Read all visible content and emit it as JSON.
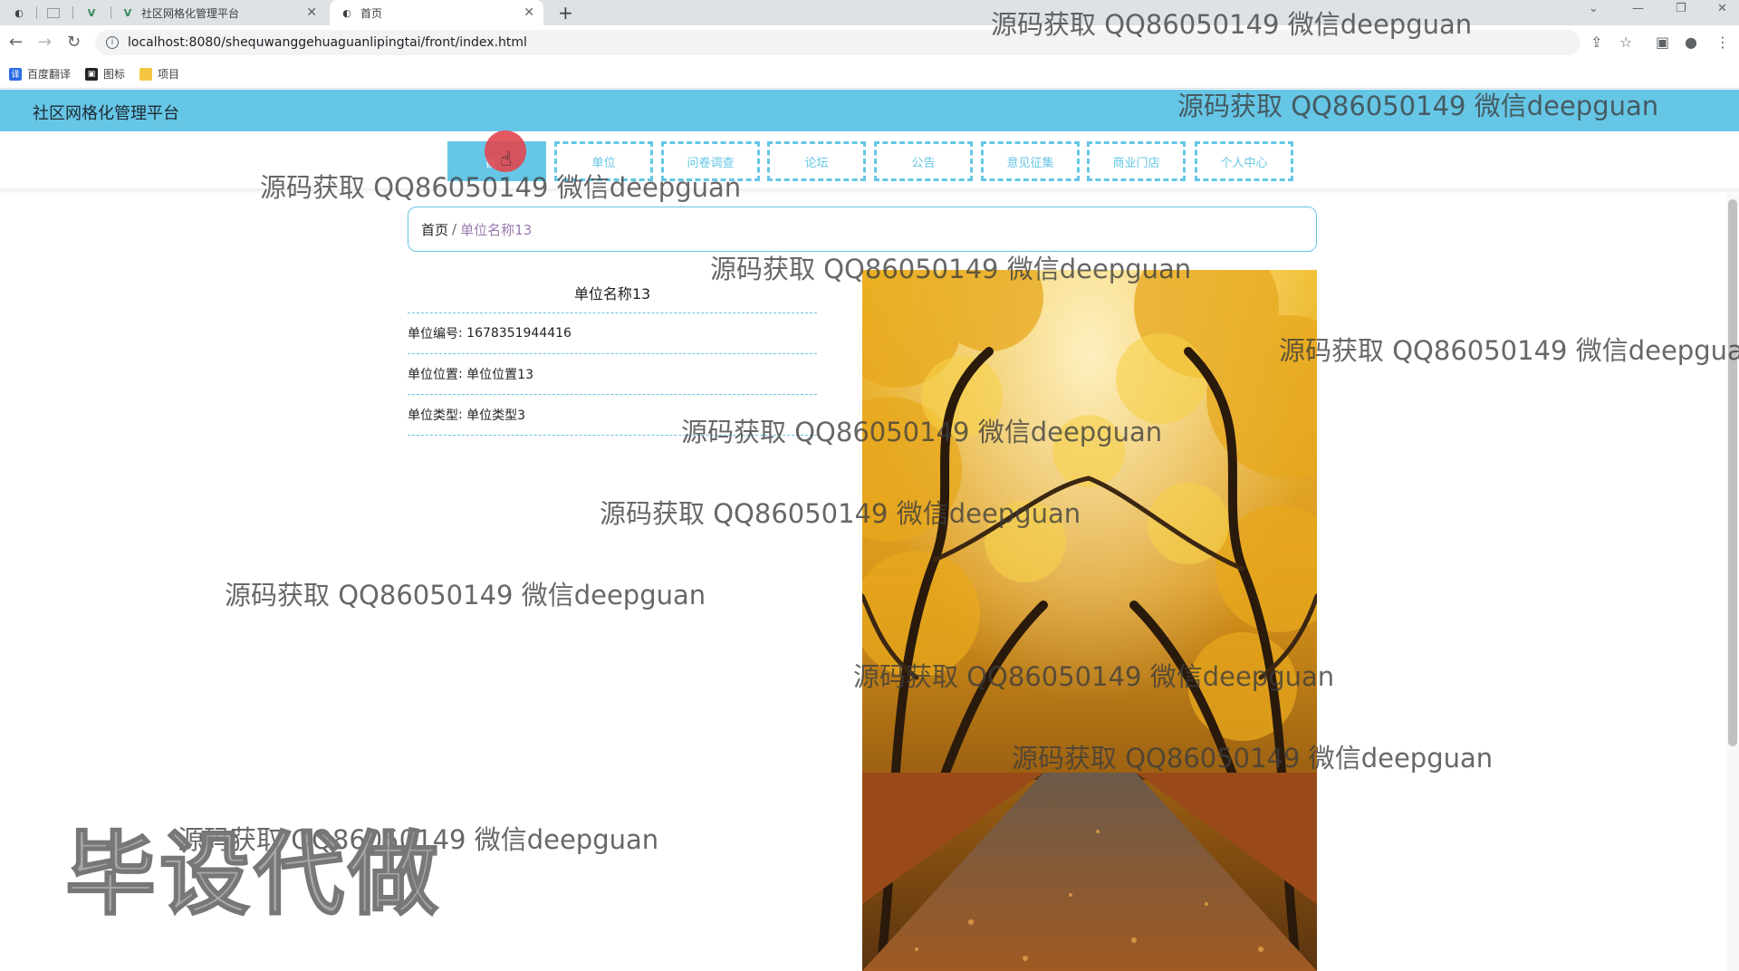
{
  "browser": {
    "tabs": [
      {
        "title": "社区网格化管理平台",
        "icon": "vue-logo-icon"
      },
      {
        "title": "首页",
        "icon": "globe-icon"
      }
    ],
    "url": "localhost:8080/shequwanggehuaguanlipingtai/front/index.html",
    "bookmarks": [
      {
        "label": "百度翻译",
        "icon": "translate-icon",
        "color": "#2b6de5"
      },
      {
        "label": "图标",
        "icon": "image-icon",
        "color": "#222222"
      },
      {
        "label": "项目",
        "icon": "folder-icon",
        "color": "#f4c542"
      }
    ]
  },
  "app": {
    "title": "社区网格化管理平台",
    "accent": "#66c6e6",
    "menu": [
      "首页",
      "单位",
      "问卷调查",
      "论坛",
      "公告",
      "意见征集",
      "商业门店",
      "个人中心"
    ],
    "active_menu": "首页"
  },
  "breadcrumb": {
    "home": "首页",
    "separator": "/",
    "current": "单位名称13"
  },
  "detail": {
    "title": "单位名称13",
    "fields": [
      {
        "label": "单位编号",
        "value": "1678351944416"
      },
      {
        "label": "单位位置",
        "value": "单位位置13"
      },
      {
        "label": "单位类型",
        "value": "单位类型3"
      }
    ]
  },
  "watermark": {
    "text": "源码获取 QQ86050149 微信deepguan",
    "big_text": "毕设代做"
  }
}
